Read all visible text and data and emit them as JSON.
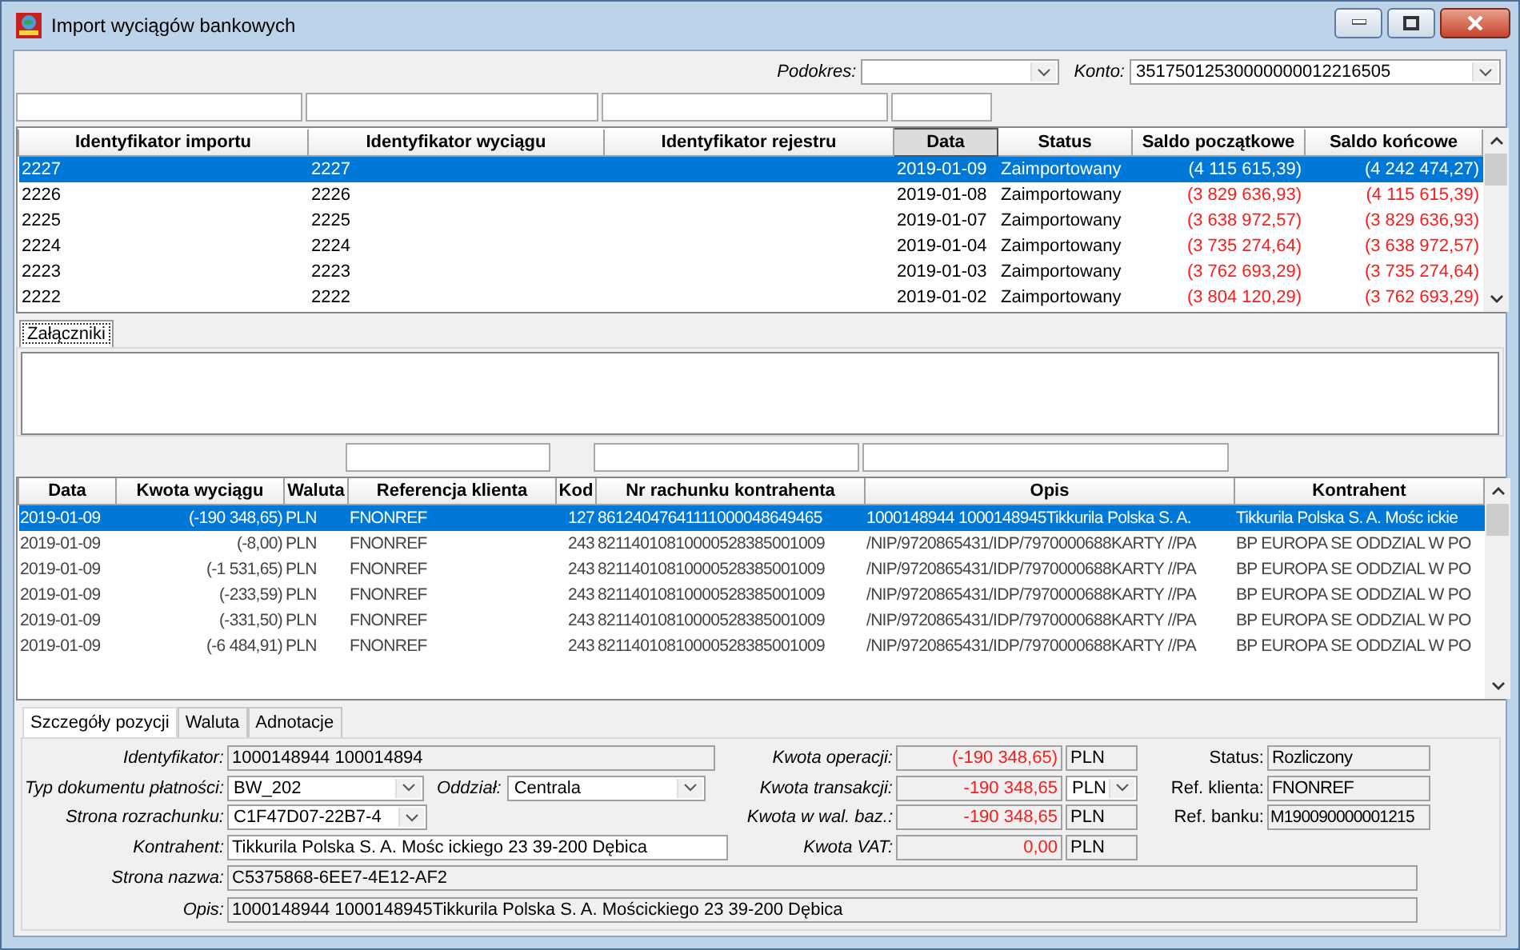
{
  "window": {
    "title": "Import wyciągów bankowych"
  },
  "toolbar": {
    "podokres": {
      "label": "Podokres:"
    },
    "konto": {
      "label": "Konto:",
      "value": "35175012530000000012216505"
    }
  },
  "imports": {
    "columns": [
      {
        "label": "Identyfikator importu",
        "filter": true,
        "sorted": false,
        "kind": "text"
      },
      {
        "label": "Identyfikator wyciągu",
        "filter": true,
        "sorted": false,
        "kind": "text"
      },
      {
        "label": "Identyfikator rejestru",
        "filter": true,
        "sorted": false,
        "kind": "text"
      },
      {
        "label": "Data",
        "filter": true,
        "sorted": true,
        "kind": "text"
      },
      {
        "label": "Status",
        "filter": false,
        "sorted": false,
        "kind": "text"
      },
      {
        "label": "Saldo początkowe",
        "filter": false,
        "sorted": false,
        "kind": "amount"
      },
      {
        "label": "Saldo końcowe",
        "filter": false,
        "sorted": false,
        "kind": "amount"
      }
    ],
    "rows": [
      {
        "selected": true,
        "cells": [
          "2227",
          "2227",
          "",
          "2019-01-09",
          "Zaimportowany",
          "(4 115 615,39)",
          "(4 242 474,27)"
        ]
      },
      {
        "selected": false,
        "cells": [
          "2226",
          "2226",
          "",
          "2019-01-08",
          "Zaimportowany",
          "(3 829 636,93)",
          "(4 115 615,39)"
        ]
      },
      {
        "selected": false,
        "cells": [
          "2225",
          "2225",
          "",
          "2019-01-07",
          "Zaimportowany",
          "(3 638 972,57)",
          "(3 829 636,93)"
        ]
      },
      {
        "selected": false,
        "cells": [
          "2224",
          "2224",
          "",
          "2019-01-04",
          "Zaimportowany",
          "(3 735 274,64)",
          "(3 638 972,57)"
        ]
      },
      {
        "selected": false,
        "cells": [
          "2223",
          "2223",
          "",
          "2019-01-03",
          "Zaimportowany",
          "(3 762 693,29)",
          "(3 735 274,64)"
        ]
      },
      {
        "selected": false,
        "cells": [
          "2222",
          "2222",
          "",
          "2019-01-02",
          "Zaimportowany",
          "(3 804 120,29)",
          "(3 762 693,29)"
        ]
      }
    ]
  },
  "attachments_tabs": [
    {
      "label": "Załączniki",
      "selected": true
    }
  ],
  "positions": {
    "columns": [
      {
        "label": "Data",
        "filter": false,
        "kind": "text"
      },
      {
        "label": "Kwota wyciągu",
        "filter": false,
        "kind": "number"
      },
      {
        "label": "Waluta",
        "filter": false,
        "kind": "text"
      },
      {
        "label": "Referencja klienta",
        "filter": true,
        "kind": "text"
      },
      {
        "label": "Kod",
        "filter": false,
        "kind": "number"
      },
      {
        "label": "Nr rachunku  kontrahenta",
        "filter": true,
        "kind": "text"
      },
      {
        "label": "Opis",
        "filter": true,
        "kind": "text"
      },
      {
        "label": "Kontrahent",
        "filter": false,
        "kind": "text"
      }
    ],
    "rows": [
      {
        "selected": true,
        "cells": [
          "2019-01-09",
          "(-190 348,65)",
          "PLN",
          "FNONREF",
          "127",
          "86124047641111000048649465",
          "1000148944 1000148945Tikkurila Polska S. A.",
          "Tikkurila Polska S. A. Mośc ickie"
        ]
      },
      {
        "selected": false,
        "cells": [
          "2019-01-09",
          "(-8,00)",
          "PLN",
          "FNONREF",
          "243",
          "82114010810000528385001009",
          "/NIP/9720865431/IDP/7970000688KARTY //PA",
          "BP EUROPA SE ODDZIAL W PO"
        ]
      },
      {
        "selected": false,
        "cells": [
          "2019-01-09",
          "(-1 531,65)",
          "PLN",
          "FNONREF",
          "243",
          "82114010810000528385001009",
          "/NIP/9720865431/IDP/7970000688KARTY //PA",
          "BP EUROPA SE ODDZIAL W PO"
        ]
      },
      {
        "selected": false,
        "cells": [
          "2019-01-09",
          "(-233,59)",
          "PLN",
          "FNONREF",
          "243",
          "82114010810000528385001009",
          "/NIP/9720865431/IDP/7970000688KARTY //PA",
          "BP EUROPA SE ODDZIAL W PO"
        ]
      },
      {
        "selected": false,
        "cells": [
          "2019-01-09",
          "(-331,50)",
          "PLN",
          "FNONREF",
          "243",
          "82114010810000528385001009",
          "/NIP/9720865431/IDP/7970000688KARTY //PA",
          "BP EUROPA SE ODDZIAL W PO"
        ]
      },
      {
        "selected": false,
        "cells": [
          "2019-01-09",
          "(-6 484,91)",
          "PLN",
          "FNONREF",
          "243",
          "82114010810000528385001009",
          "/NIP/9720865431/IDP/7970000688KARTY //PA",
          "BP EUROPA SE ODDZIAL W PO"
        ]
      }
    ]
  },
  "detail_tabs": [
    {
      "label": "Szczegóły pozycji",
      "selected": true
    },
    {
      "label": "Waluta",
      "selected": false
    },
    {
      "label": "Adnotacje",
      "selected": false
    }
  ],
  "details": {
    "left": [
      {
        "label": "Identyfikator:",
        "value": "1000148944 100014894",
        "kind": "readonly"
      },
      {
        "label": "Typ dokumentu płatności:",
        "value": "BW_202",
        "kind": "combo",
        "extra": {
          "label": "Oddział:",
          "value": "Centrala",
          "kind": "combo"
        }
      },
      {
        "label": "Strona rozrachunku:",
        "value": "C1F47D07-22B7-4",
        "kind": "combo"
      },
      {
        "label": "Kontrahent:",
        "value": "Tikkurila Polska S. A. Mośc ickiego 23 39-200 Dębica",
        "kind": "input"
      }
    ],
    "amounts": [
      {
        "label": "Kwota operacji:",
        "value": "(-190 348,65)",
        "currency": "PLN",
        "currency_dropdown": false
      },
      {
        "label": "Kwota transakcji:",
        "value": "-190 348,65",
        "currency": "PLN",
        "currency_dropdown": true
      },
      {
        "label": "Kwota w wal. baz.:",
        "value": "-190 348,65",
        "currency": "PLN",
        "currency_dropdown": false
      },
      {
        "label": "Kwota VAT:",
        "value": "0,00",
        "currency": "PLN",
        "currency_dropdown": false
      }
    ],
    "refs": [
      {
        "label": "Status:",
        "value": "Rozliczony"
      },
      {
        "label": "Ref. klienta:",
        "value": "FNONREF"
      },
      {
        "label": "Ref. banku:",
        "value": "M190090000001215"
      }
    ],
    "wide": [
      {
        "label": "Strona nazwa:",
        "value": "C5375868-6EE7-4E12-AF2"
      },
      {
        "label": "Opis:",
        "value": "1000148944 1000148945Tikkurila Polska S. A. Mościckiego 23 39-200 Dębica"
      }
    ]
  }
}
